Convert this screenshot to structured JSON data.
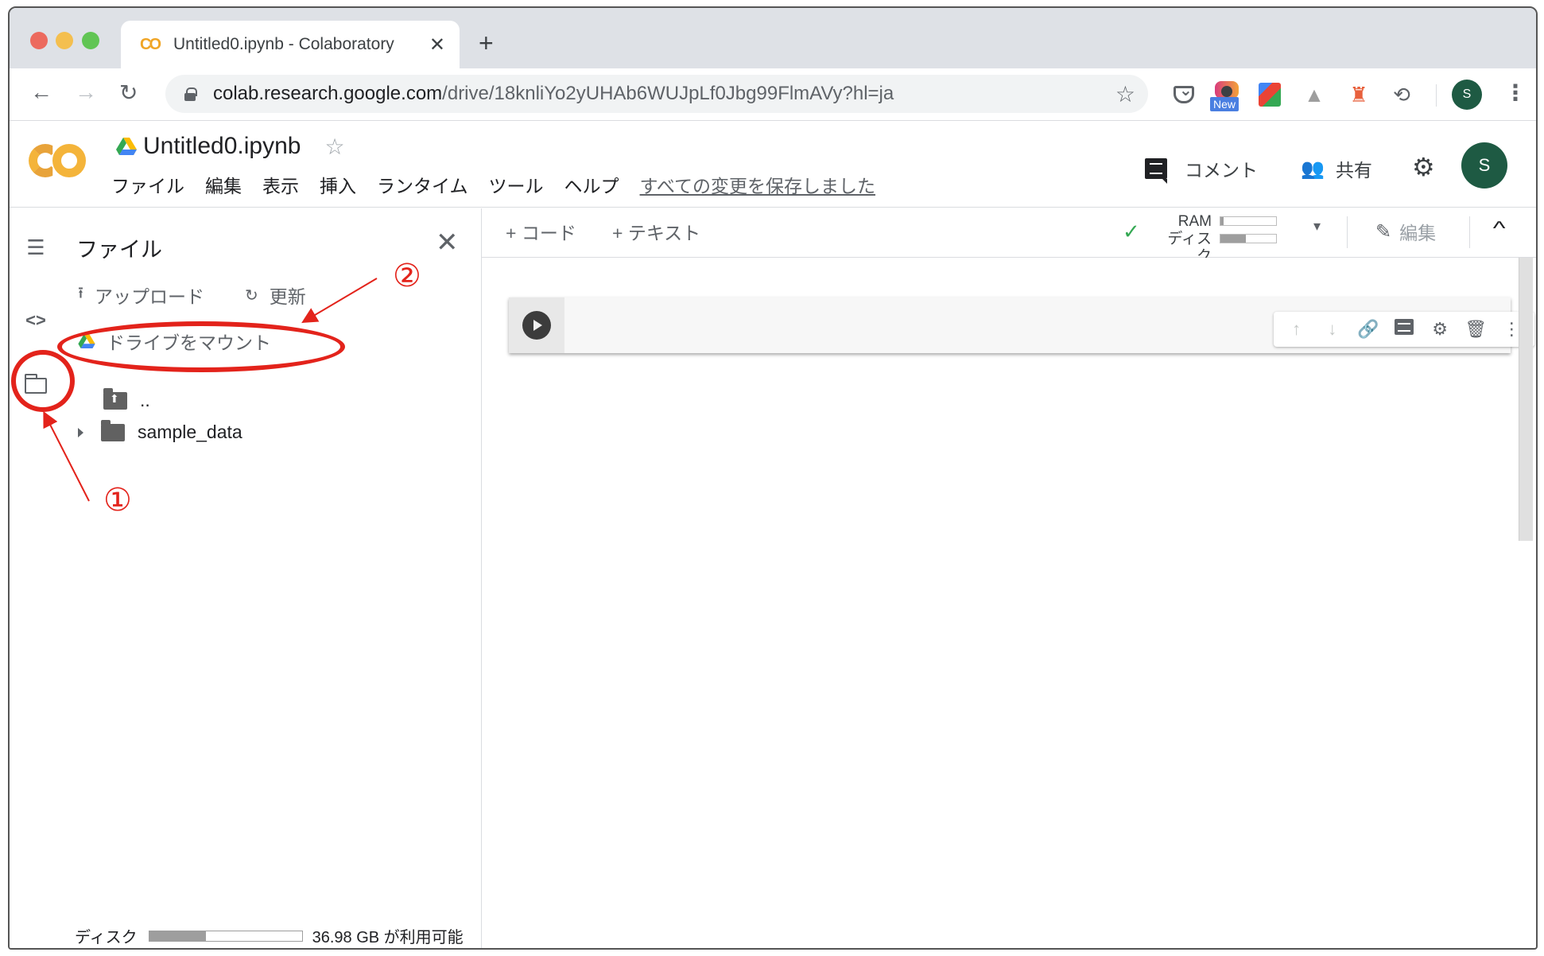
{
  "browser": {
    "tab": {
      "favicon": "colab-logo-icon",
      "title": "Untitled0.ipynb - Colaboratory",
      "close_label": "✕"
    },
    "new_tab_label": "+",
    "nav": {
      "back": "←",
      "forward": "→",
      "reload": "↻"
    },
    "address": {
      "host": "colab.research.google.com",
      "path": "/drive/18knliYo2yUHAb6WUJpLf0Jbg99FlmAVy?hl=ja"
    },
    "bookmark_star": "☆",
    "extensions": [
      {
        "name": "pocket-extension"
      },
      {
        "name": "camera-extension",
        "badge": "New"
      },
      {
        "name": "google-extension"
      },
      {
        "name": "drive-extension",
        "glyph": "▲"
      },
      {
        "name": "lighthouse-extension",
        "glyph": "♜"
      },
      {
        "name": "history-extension",
        "glyph": "⟲"
      }
    ],
    "profile_initial": "S",
    "menu_glyph": "⋮"
  },
  "colab": {
    "notebook_title": "Untitled0.ipynb",
    "star": "☆",
    "menu": [
      "ファイル",
      "編集",
      "表示",
      "挿入",
      "ランタイム",
      "ツール",
      "ヘルプ"
    ],
    "save_status": "すべての変更を保存しました",
    "header_buttons": {
      "comment": "コメント",
      "share": "共有",
      "share_icon": "👥",
      "settings_icon": "⚙"
    },
    "avatar_initial": "S"
  },
  "sidebar": {
    "rail": {
      "toc": "☰",
      "code": "<>"
    },
    "panel_title": "ファイル",
    "close": "✕",
    "actions": {
      "upload": "アップロード",
      "upload_icon": "⭱",
      "refresh": "更新",
      "refresh_icon": "↻",
      "mount_drive": "ドライブをマウント"
    },
    "tree": [
      {
        "name": "..",
        "type": "parent-folder"
      },
      {
        "name": "sample_data",
        "type": "folder",
        "expandable": true
      }
    ],
    "disk": {
      "label": "ディスク",
      "usage_fraction": 0.37,
      "available": "36.98 GB が利用可能"
    }
  },
  "toolbar": {
    "add_code": "+ コード",
    "add_text": "+ テキスト",
    "status_check": "✓",
    "ram_label": "RAM",
    "disk_label": "ディスク",
    "ram_usage_fraction": 0.05,
    "disk_usage_fraction": 0.45,
    "dropdown": "▾",
    "edit_label": "編集",
    "edit_icon": "✎",
    "collapse": "^"
  },
  "cell_toolbar": {
    "move_up": "↑",
    "move_down": "↓",
    "link": "🔗",
    "settings": "⚙",
    "delete": "🗑",
    "more": "⋮"
  },
  "annotations": {
    "step1": "①",
    "step2": "②"
  },
  "colors": {
    "accent_red": "#e3231b",
    "colab_orange": "#f3a82f",
    "avatar_green": "#1e5a43",
    "check_green": "#34a853"
  }
}
